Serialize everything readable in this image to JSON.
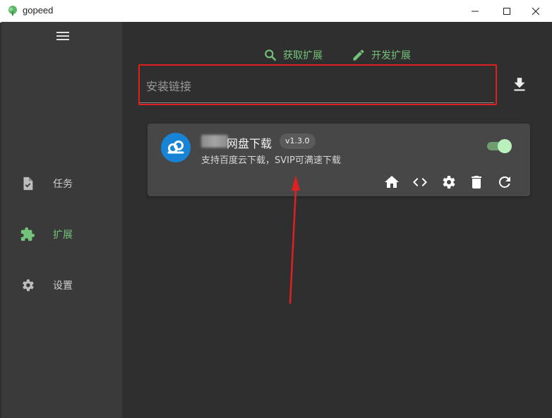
{
  "window": {
    "title": "gopeed",
    "minimize_icon": "minimize-icon",
    "maximize_icon": "maximize-icon",
    "close_icon": "close-icon"
  },
  "sidebar": {
    "menu_icon": "hamburger-menu-icon",
    "items": [
      {
        "label": "任务",
        "icon": "task-document-icon",
        "active": false
      },
      {
        "label": "扩展",
        "icon": "puzzle-piece-icon",
        "active": true
      },
      {
        "label": "设置",
        "icon": "gear-icon",
        "active": false
      }
    ]
  },
  "toolbar": {
    "get_extension_label": "获取扩展",
    "develop_extension_label": "开发扩展"
  },
  "install": {
    "placeholder": "安装链接",
    "value": ""
  },
  "extension": {
    "name": "网盘下载",
    "version": "v1.3.0",
    "description": "支持百度云下载，SVIP可满速下载",
    "enabled": true,
    "tools": [
      "home-icon",
      "code-icon",
      "settings-icon",
      "delete-icon",
      "refresh-icon"
    ]
  },
  "colors": {
    "accent": "#74c37a",
    "annotation": "#e02020",
    "sidebar_bg": "#3a3a3a",
    "main_bg": "#2f2f2f",
    "card_bg": "#474747"
  }
}
